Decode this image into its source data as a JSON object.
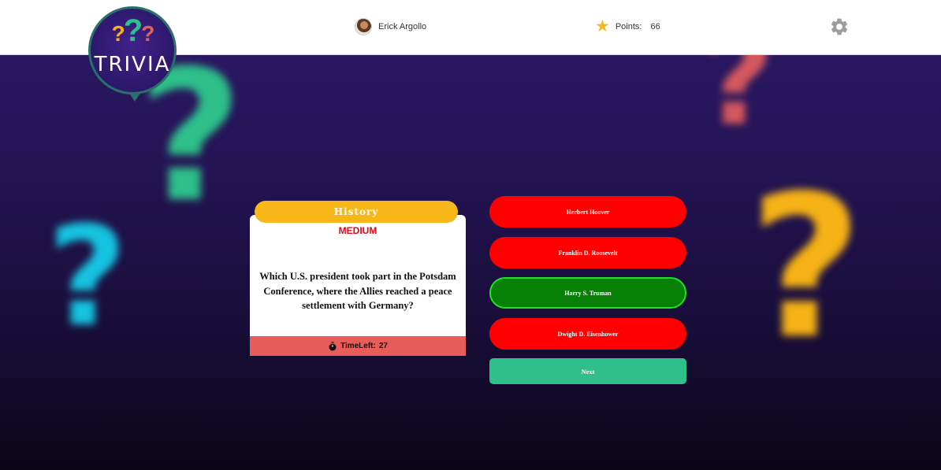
{
  "logo": {
    "q1": "?",
    "q2": "?",
    "q3": "?",
    "text": "TRIVIA"
  },
  "header": {
    "user_name": "Erick Argollo",
    "points_label": "Points:",
    "points_value": "66"
  },
  "colors": {
    "accent_yellow": "#f7b718",
    "wrong_red": "#ff0000",
    "correct_green": "#088008",
    "next_green": "#2ebf8a",
    "timer_red": "#e85c5a",
    "difficulty_red": "#e30613"
  },
  "icons": {
    "avatar": "user-avatar",
    "points": "star-icon",
    "settings": "gear-icon",
    "timer": "stopwatch-icon"
  },
  "card": {
    "category": "History",
    "difficulty": "MEDIUM",
    "question": "Which U.S. president took part in the Potsdam Conference, where the Allies reached a peace settlement with Germany?",
    "timer_label": "TimeLeft:",
    "timer_value": "27"
  },
  "answers": [
    {
      "label": "Herbert Hoover",
      "state": "wrong"
    },
    {
      "label": "Franklin D. Roosevelt",
      "state": "wrong"
    },
    {
      "label": "Harry S. Truman",
      "state": "correct"
    },
    {
      "label": "Dwight D. Eisenhower",
      "state": "wrong"
    }
  ],
  "next_label": "Next"
}
